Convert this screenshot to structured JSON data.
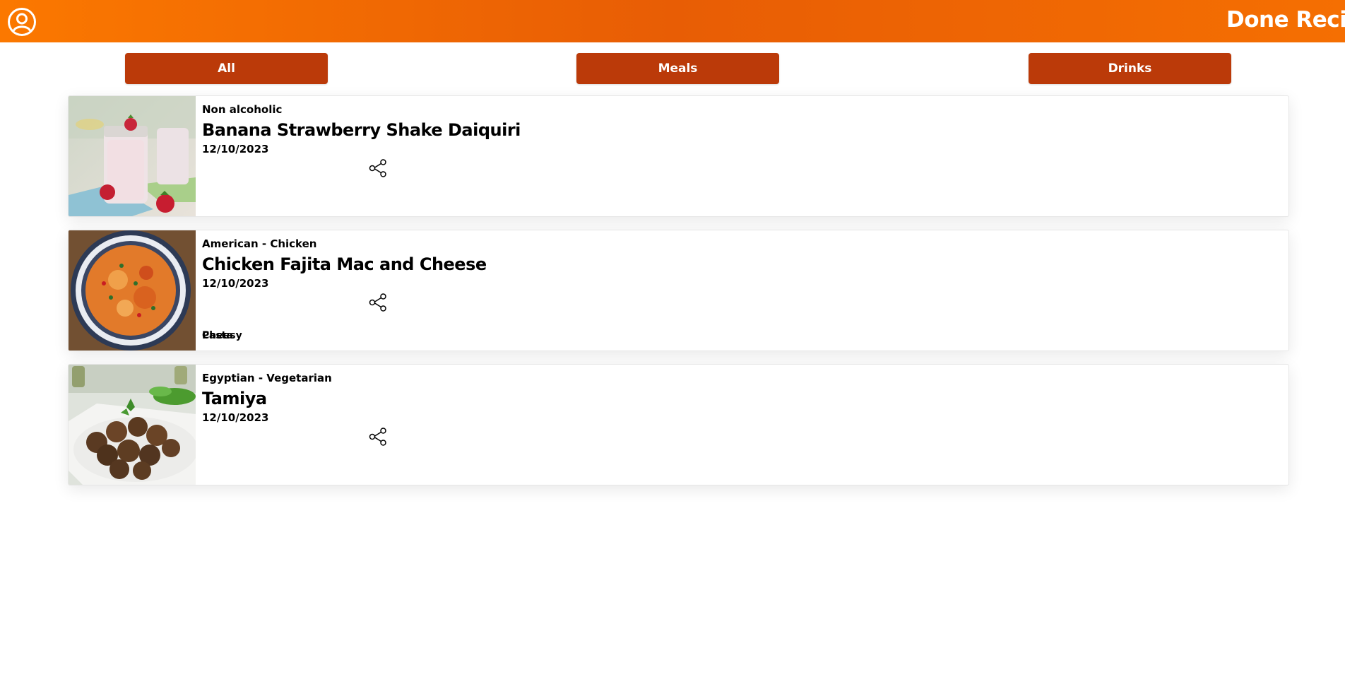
{
  "header": {
    "title": "Done Recipes",
    "profile_icon": "user-circle-icon",
    "colors": {
      "gradient_start": "#fb7800",
      "gradient_mid": "#e85d05",
      "gradient_end": "#f56f02"
    }
  },
  "filters": {
    "all_label": "All",
    "meals_label": "Meals",
    "drinks_label": "Drinks",
    "button_color": "#bb3a09"
  },
  "recipes": [
    {
      "category": "Non alcoholic",
      "name": "Banana Strawberry Shake Daiquiri",
      "done_date": "12/10/2023",
      "share_icon": "share-icon",
      "image": "strawberry-banana-shake-photo"
    },
    {
      "category": "American - Chicken",
      "name": "Chicken Fajita Mac and Cheese",
      "done_date": "12/10/2023",
      "share_icon": "share-icon",
      "image": "chicken-fajita-pasta-photo",
      "tags": [
        "Pasta",
        "Cheesy"
      ]
    },
    {
      "category": "Egyptian - Vegetarian",
      "name": "Tamiya",
      "done_date": "12/10/2023",
      "share_icon": "share-icon",
      "image": "falafel-photo"
    }
  ]
}
